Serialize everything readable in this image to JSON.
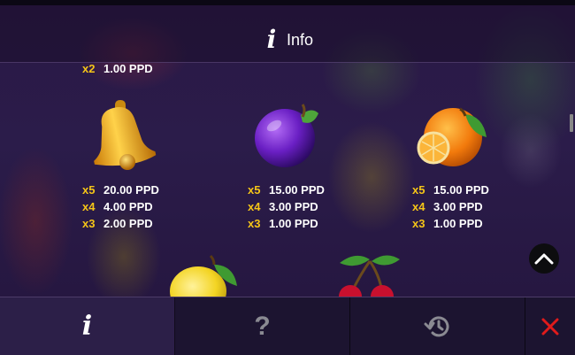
{
  "header": {
    "title": "Info",
    "icon": "info-icon"
  },
  "paytable": {
    "top_row": {
      "mult": "x2",
      "amount": "1.00 PPD"
    },
    "symbols": [
      {
        "name": "bell",
        "payouts": [
          {
            "mult": "x5",
            "amount": "20.00 PPD"
          },
          {
            "mult": "x4",
            "amount": "4.00 PPD"
          },
          {
            "mult": "x3",
            "amount": "2.00 PPD"
          }
        ]
      },
      {
        "name": "plum",
        "payouts": [
          {
            "mult": "x5",
            "amount": "15.00 PPD"
          },
          {
            "mult": "x4",
            "amount": "3.00 PPD"
          },
          {
            "mult": "x3",
            "amount": "1.00 PPD"
          }
        ]
      },
      {
        "name": "orange",
        "payouts": [
          {
            "mult": "x5",
            "amount": "15.00 PPD"
          },
          {
            "mult": "x4",
            "amount": "3.00 PPD"
          },
          {
            "mult": "x3",
            "amount": "1.00 PPD"
          }
        ]
      }
    ],
    "partial_symbols": [
      "lemon",
      "cherry"
    ]
  },
  "footer": {
    "tabs": [
      {
        "name": "info",
        "icon": "info-icon",
        "active": true
      },
      {
        "name": "help",
        "icon": "question-mark-icon",
        "label": "?"
      },
      {
        "name": "history",
        "icon": "history-icon"
      },
      {
        "name": "close",
        "icon": "close-icon"
      }
    ],
    "close_color": "#e01b1b"
  },
  "colors": {
    "multiplier": "#f5c518",
    "amount": "#ffffff",
    "accent_text": "#ffffff"
  }
}
